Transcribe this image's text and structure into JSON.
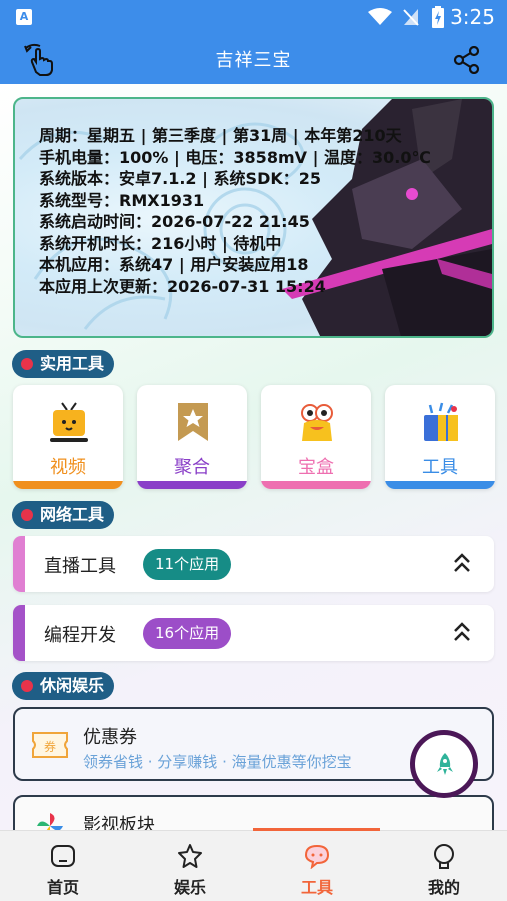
{
  "status_bar": {
    "time": "3:25",
    "app_icon_letter": "A"
  },
  "app_bar": {
    "title": "吉祥三宝",
    "back_icon": "hand-pointer-icon",
    "share_icon": "share-icon",
    "color": "#3d8dea"
  },
  "banner": {
    "lines": [
      "周期：星期五 | 第三季度 | 第31周 | 本年第210天",
      "手机电量：100% | 电压：3858mV | 温度：30.0℃",
      "系统版本：安卓7.1.2 | 系统SDK：25",
      "系统型号：RMX1931",
      "系统启动时间：2026-07-22 21:45",
      "系统开机时长：216小时 | 待机中",
      "本机应用：系统47 | 用户安装应用18",
      "本应用上次更新：2026-07-31 15:24"
    ]
  },
  "sections": {
    "tools": "实用工具",
    "network": "网络工具",
    "leisure": "休闲娱乐"
  },
  "tool_cards": [
    {
      "label": "视频",
      "color": "#f0901e",
      "icon": "tv-icon"
    },
    {
      "label": "聚合",
      "color": "#8a3fc8",
      "icon": "bookmark-star-icon"
    },
    {
      "label": "宝盒",
      "color": "#ee6fb0",
      "icon": "mascot-icon"
    },
    {
      "label": "工具",
      "color": "#3a8de6",
      "icon": "gift-box-icon"
    }
  ],
  "network_rows": [
    {
      "title": "直播工具",
      "badge": "11个应用",
      "accent": "#e07fd2",
      "badge_color": "#168c86"
    },
    {
      "title": "编程开发",
      "badge": "16个应用",
      "accent": "#a452c8",
      "badge_color": "#9c4ec8"
    }
  ],
  "leisure": {
    "coupon_title": "优惠券",
    "coupon_sub": "领券省钱 · 分享赚钱 · 海量优惠等你挖宝",
    "coupon_icon_text": "券",
    "movie_title": "影视板块"
  },
  "bottom_nav": [
    {
      "label": "首页",
      "icon": "home-icon",
      "active": false
    },
    {
      "label": "娱乐",
      "icon": "star-icon",
      "active": false
    },
    {
      "label": "工具",
      "icon": "chat-bubble-icon",
      "active": true
    },
    {
      "label": "我的",
      "icon": "person-icon",
      "active": false
    }
  ],
  "accent_active": "#f2653a"
}
